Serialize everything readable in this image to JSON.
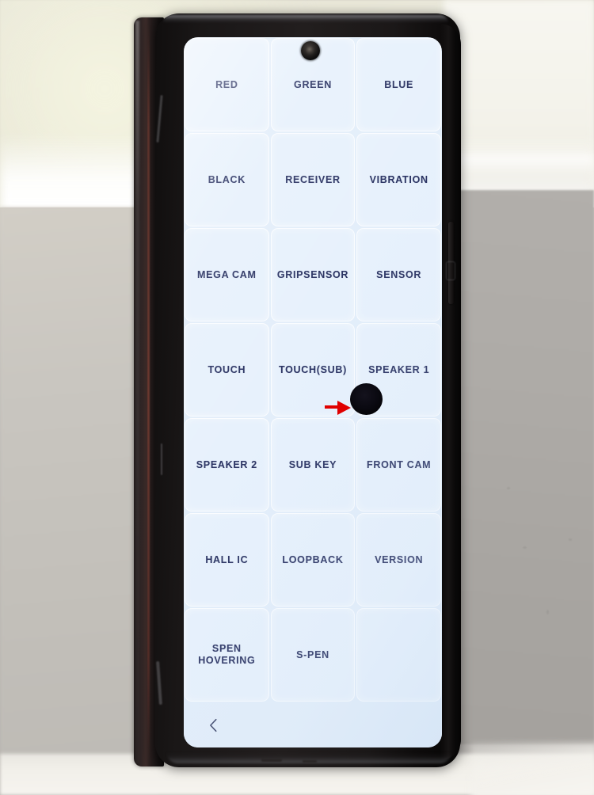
{
  "device": {
    "kind": "foldable-smartphone",
    "screen_background_color": "#e3eefa",
    "cell_background_color": "#e7f1fc",
    "label_color": "#2b3463",
    "body_color": "#1a1717"
  },
  "screen": {
    "app": "hardware-diagnostics-test-menu",
    "grid": {
      "columns": 3,
      "rows": 7,
      "cells": [
        {
          "label": "RED",
          "empty": false
        },
        {
          "label": "GREEN",
          "empty": false
        },
        {
          "label": "BLUE",
          "empty": false
        },
        {
          "label": "BLACK",
          "empty": false
        },
        {
          "label": "RECEIVER",
          "empty": false
        },
        {
          "label": "VIBRATION",
          "empty": false
        },
        {
          "label": "MEGA CAM",
          "empty": false
        },
        {
          "label": "GRIPSENSOR",
          "empty": false
        },
        {
          "label": "SENSOR",
          "empty": false
        },
        {
          "label": "TOUCH",
          "empty": false
        },
        {
          "label": "TOUCH(SUB)",
          "empty": false
        },
        {
          "label": "SPEAKER 1",
          "empty": false
        },
        {
          "label": "SPEAKER 2",
          "empty": false
        },
        {
          "label": "SUB KEY",
          "empty": false
        },
        {
          "label": "FRONT CAM",
          "empty": false
        },
        {
          "label": "HALL IC",
          "empty": false
        },
        {
          "label": "LOOPBACK",
          "empty": false
        },
        {
          "label": "VERSION",
          "empty": false
        },
        {
          "label": "SPEN\nHOVERING",
          "empty": false
        },
        {
          "label": "S-PEN",
          "empty": false
        },
        {
          "label": "",
          "empty": true
        }
      ]
    },
    "navbar": {
      "back_glyph": "‹"
    },
    "annotation": {
      "arrow_color": "#e00000",
      "arrow_direction": "right",
      "points_to": "punch-hole-front-camera-cutout"
    },
    "cutouts": {
      "top_camera": "top-center-punch-hole-camera",
      "highlighted_camera": "under-display-punch-hole-camera"
    }
  }
}
